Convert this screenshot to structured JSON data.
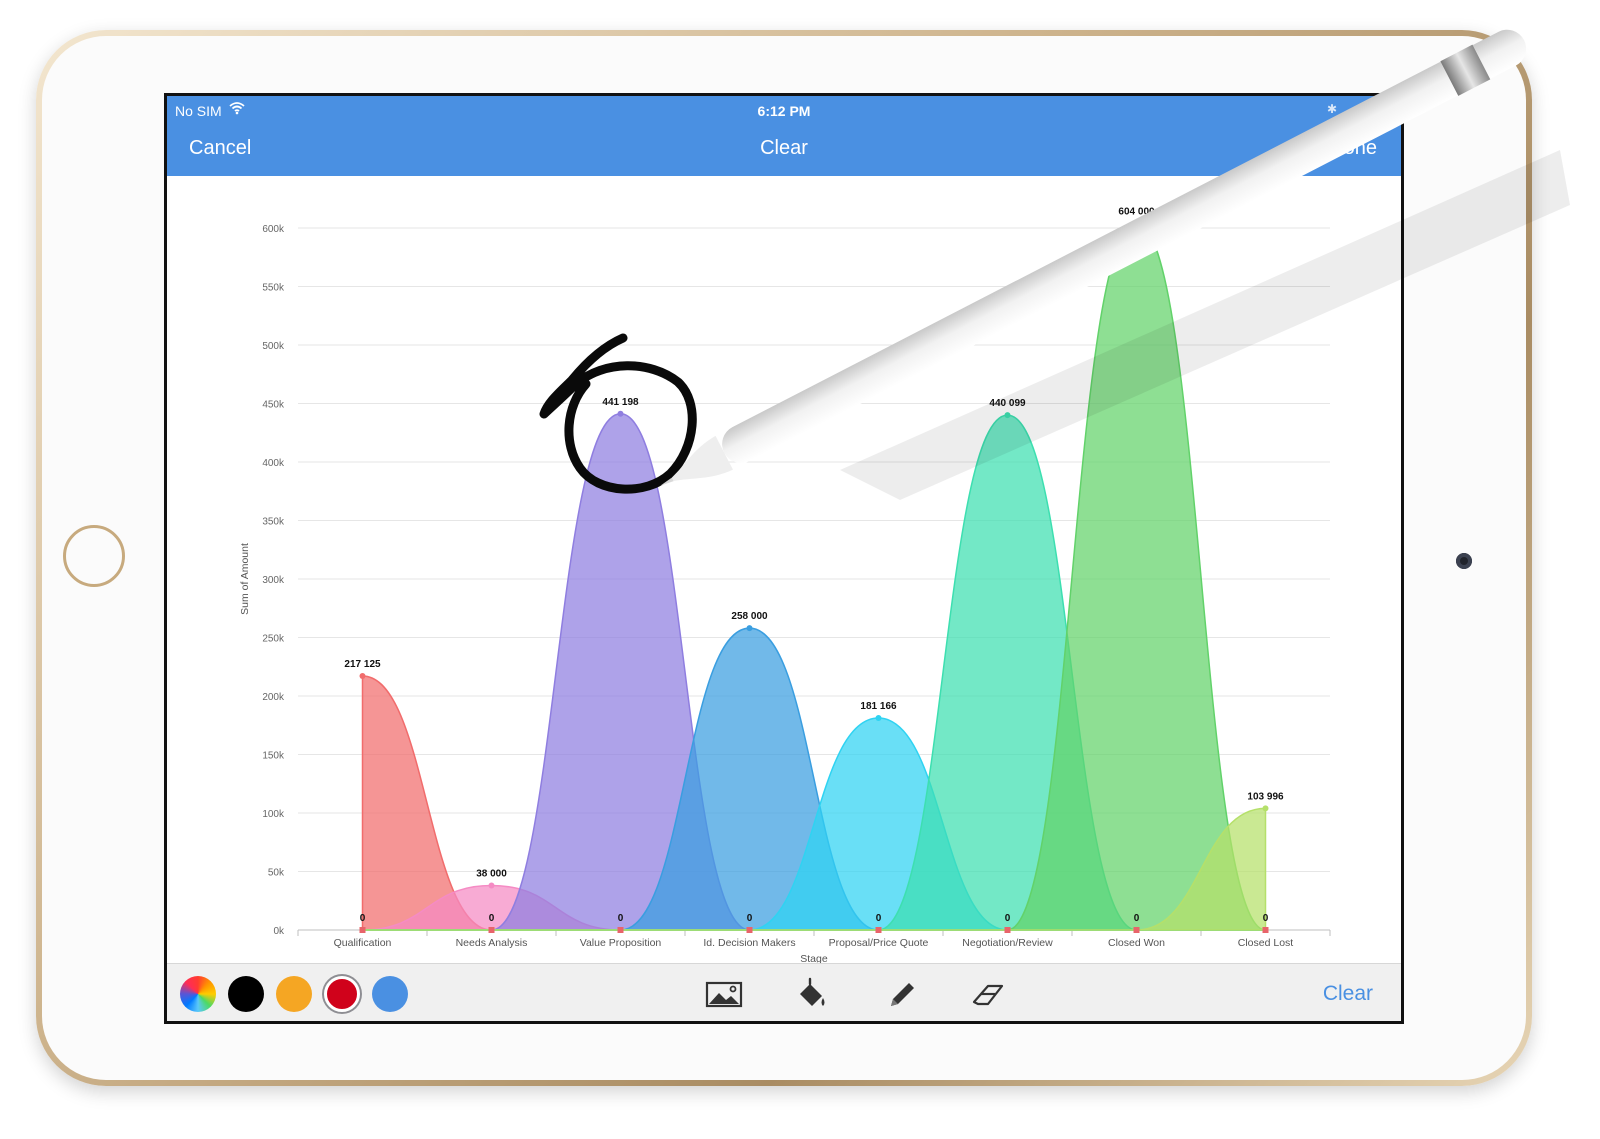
{
  "status_bar": {
    "carrier": "No SIM",
    "time": "6:12 PM",
    "bluetooth": "✱"
  },
  "nav": {
    "cancel": "Cancel",
    "title": "Clear",
    "done": "Done"
  },
  "toolbar": {
    "colors": [
      {
        "name": "rainbow",
        "value": "multicolor"
      },
      {
        "name": "black",
        "value": "#000000"
      },
      {
        "name": "orange",
        "value": "#f5a623"
      },
      {
        "name": "red",
        "value": "#d0021b",
        "selected": true
      },
      {
        "name": "blue",
        "value": "#4a90e2"
      }
    ],
    "tools": [
      "image-icon",
      "fill-icon",
      "pencil-icon",
      "eraser-icon"
    ],
    "clear_label": "Clear"
  },
  "accent_color": "#4a90e2",
  "annotation": {
    "stroke_color": "#000000",
    "target": "Value Proposition"
  },
  "chart_data": {
    "type": "area",
    "xlabel": "Stage",
    "ylabel": "Sum of Amount",
    "ylim": [
      0,
      600000
    ],
    "yticks": [
      "0k",
      "50k",
      "100k",
      "150k",
      "200k",
      "250k",
      "300k",
      "350k",
      "400k",
      "450k",
      "500k",
      "550k",
      "600k"
    ],
    "grid": true,
    "categories": [
      "Qualification",
      "Needs Analysis",
      "Value Proposition",
      "Id. Decision Makers",
      "Proposal/Price Quote",
      "Negotiation/Review",
      "Closed Won",
      "Closed Lost"
    ],
    "series": [
      {
        "values": [
          217125,
          0,
          0,
          0,
          0,
          0,
          0,
          0
        ],
        "color": "#f16c6c"
      },
      {
        "values": [
          0,
          38000,
          0,
          0,
          0,
          0,
          0,
          0
        ],
        "color": "#f58bc4"
      },
      {
        "values": [
          0,
          0,
          441198,
          0,
          0,
          0,
          0,
          0
        ],
        "color": "#8f7ee0"
      },
      {
        "values": [
          0,
          0,
          0,
          258000,
          0,
          0,
          0,
          0
        ],
        "color": "#3a9ee0"
      },
      {
        "values": [
          0,
          0,
          0,
          0,
          181166,
          0,
          0,
          0
        ],
        "color": "#2fd3f2"
      },
      {
        "values": [
          0,
          0,
          0,
          0,
          0,
          440099,
          0,
          0
        ],
        "color": "#3ddfb0"
      },
      {
        "values": [
          0,
          0,
          0,
          0,
          0,
          0,
          604000,
          0
        ],
        "color": "#62d26a"
      },
      {
        "values": [
          0,
          0,
          0,
          0,
          0,
          0,
          0,
          103996
        ],
        "color": "#b5e06a"
      }
    ],
    "data_labels": [
      "217 125",
      "38 000",
      "441 198",
      "258 000",
      "181 166",
      "440 099",
      "604 000",
      "103 996"
    ],
    "zero_label": "0"
  }
}
